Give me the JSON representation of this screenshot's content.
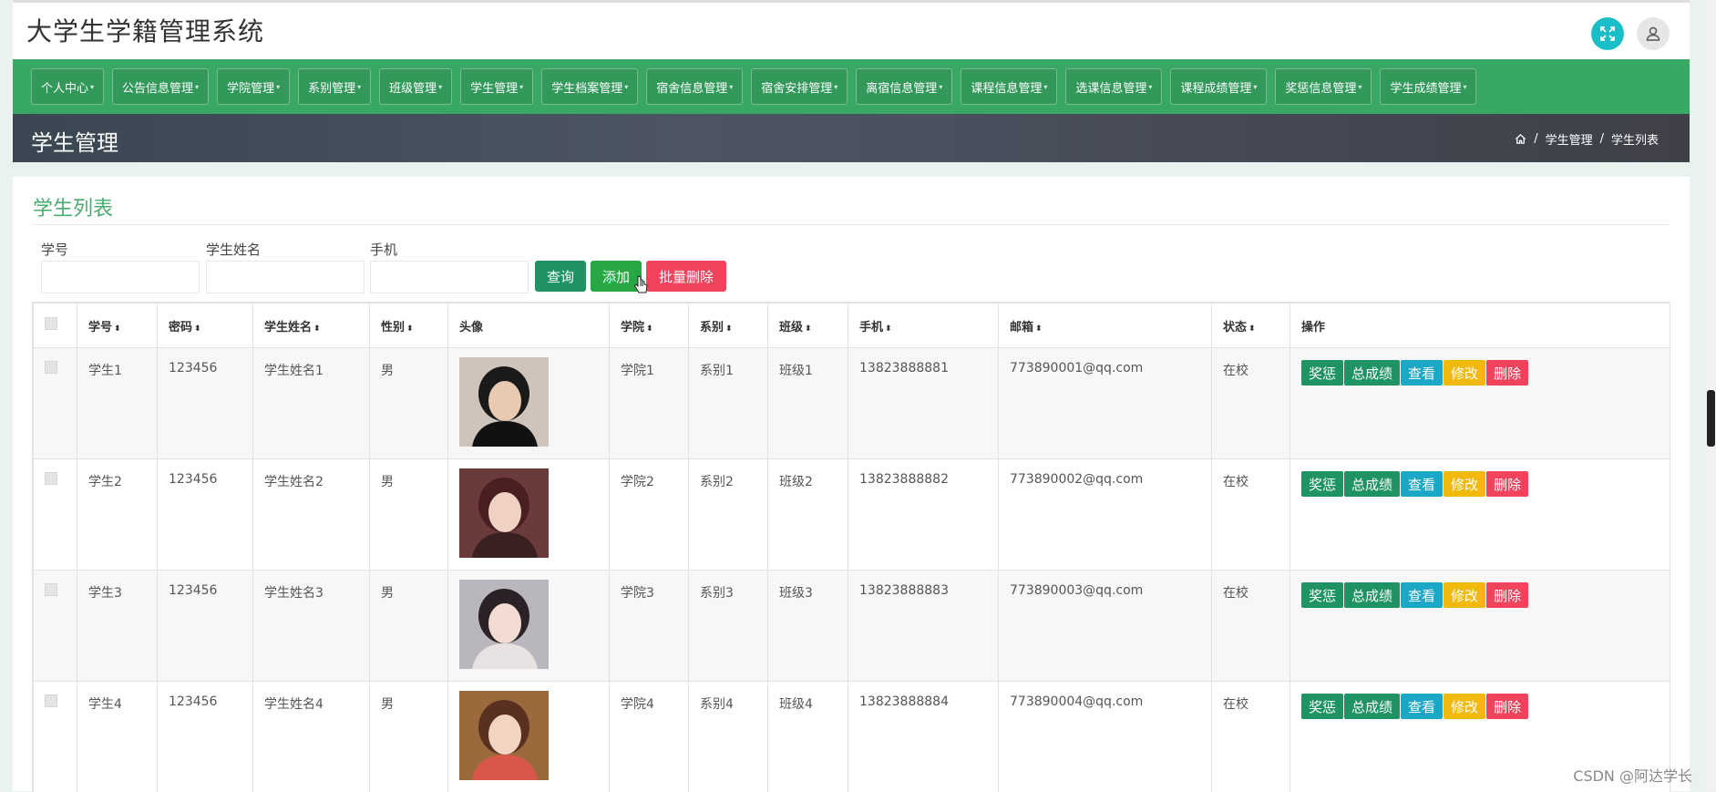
{
  "app": {
    "title": "大学生学籍管理系统"
  },
  "nav": {
    "items": [
      {
        "label": "个人中心"
      },
      {
        "label": "公告信息管理"
      },
      {
        "label": "学院管理"
      },
      {
        "label": "系别管理"
      },
      {
        "label": "班级管理"
      },
      {
        "label": "学生管理"
      },
      {
        "label": "学生档案管理"
      },
      {
        "label": "宿舍信息管理"
      },
      {
        "label": "宿舍安排管理"
      },
      {
        "label": "离宿信息管理"
      },
      {
        "label": "课程信息管理"
      },
      {
        "label": "选课信息管理"
      },
      {
        "label": "课程成绩管理"
      },
      {
        "label": "奖惩信息管理"
      },
      {
        "label": "学生成绩管理"
      }
    ]
  },
  "page": {
    "title": "学生管理",
    "breadcrumb": [
      "学生管理",
      "学生列表"
    ],
    "breadcrumb_sep": "/"
  },
  "card": {
    "title": "学生列表"
  },
  "search": {
    "fields": [
      {
        "label": "学号",
        "value": "",
        "placeholder": ""
      },
      {
        "label": "学生姓名",
        "value": "",
        "placeholder": ""
      },
      {
        "label": "手机",
        "value": "",
        "placeholder": ""
      }
    ],
    "query_label": "查询",
    "add_label": "添加",
    "batch_delete_label": "批量删除"
  },
  "table": {
    "headers": [
      "学号",
      "密码",
      "学生姓名",
      "性别",
      "头像",
      "学院",
      "系别",
      "班级",
      "手机",
      "邮箱",
      "状态",
      "操作"
    ],
    "sortable": [
      true,
      true,
      true,
      true,
      false,
      true,
      true,
      true,
      true,
      true,
      true,
      false
    ],
    "rows": [
      {
        "id": "学生1",
        "password": "123456",
        "name": "学生姓名1",
        "gender": "男",
        "college": "学院1",
        "department": "系别1",
        "class": "班级1",
        "phone": "13823888881",
        "email": "773890001@qq.com",
        "status": "在校"
      },
      {
        "id": "学生2",
        "password": "123456",
        "name": "学生姓名2",
        "gender": "男",
        "college": "学院2",
        "department": "系别2",
        "class": "班级2",
        "phone": "13823888882",
        "email": "773890002@qq.com",
        "status": "在校"
      },
      {
        "id": "学生3",
        "password": "123456",
        "name": "学生姓名3",
        "gender": "男",
        "college": "学院3",
        "department": "系别3",
        "class": "班级3",
        "phone": "13823888883",
        "email": "773890003@qq.com",
        "status": "在校"
      },
      {
        "id": "学生4",
        "password": "123456",
        "name": "学生姓名4",
        "gender": "男",
        "college": "学院4",
        "department": "系别4",
        "class": "班级4",
        "phone": "13823888884",
        "email": "773890004@qq.com",
        "status": "在校"
      }
    ],
    "row_actions": [
      {
        "label": "奖惩",
        "color": "#1f9363"
      },
      {
        "label": "总成绩",
        "color": "#1f9363"
      },
      {
        "label": "查看",
        "color": "#1ba8c6"
      },
      {
        "label": "修改",
        "color": "#f0b90b"
      },
      {
        "label": "删除",
        "color": "#f0435c"
      }
    ]
  },
  "colors": {
    "nav_bg": "#3aa865",
    "accent_green": "#4aac70",
    "query_btn": "#1f9363",
    "add_btn": "#28a745",
    "delete_btn": "#f0435c",
    "fullscreen_btn": "#1abec8"
  },
  "watermark": "CSDN @阿达学长"
}
